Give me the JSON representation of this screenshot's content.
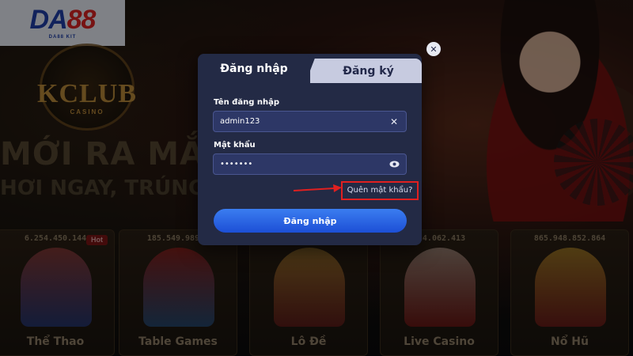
{
  "brand": {
    "logo_main": "DA",
    "logo_accent": "88",
    "logo_sub": "DA88 KIT"
  },
  "background": {
    "emblem_word": "KCLUB",
    "emblem_sub": "CASINO",
    "hero_title": "MỚI RA MẮT",
    "hero_subtitle": "HƠI NGAY, TRÚNG LỚN"
  },
  "games": [
    {
      "jackpot": "6.254.450.144",
      "name": "Thể Thao",
      "badge": "Hot"
    },
    {
      "jackpot": "185.549.989.5",
      "name": "Table Games",
      "badge": ""
    },
    {
      "jackpot": "",
      "name": "Lô Đề",
      "badge": ""
    },
    {
      "jackpot": "824.062.413",
      "name": "Live Casino",
      "badge": ""
    },
    {
      "jackpot": "865.948.852.864",
      "name": "Nổ Hũ",
      "badge": ""
    }
  ],
  "modal": {
    "tabs": {
      "login": "Đăng nhập",
      "register": "Đăng ký"
    },
    "username": {
      "label": "Tên đăng nhập",
      "value": "admin123",
      "clear_icon": "close-icon"
    },
    "password": {
      "label": "Mật khẩu",
      "value": "•••••••",
      "toggle_icon": "eye-icon"
    },
    "forgot_link": "Quên mật khẩu?",
    "submit": "Đăng nhập",
    "close_icon": "close-icon"
  },
  "colors": {
    "modal_bg": "#232a45",
    "field_bg": "#2d3766",
    "primary_button": "#2a66e6",
    "highlight_box": "#e02020",
    "tab_inactive": "#c7cbe0"
  }
}
